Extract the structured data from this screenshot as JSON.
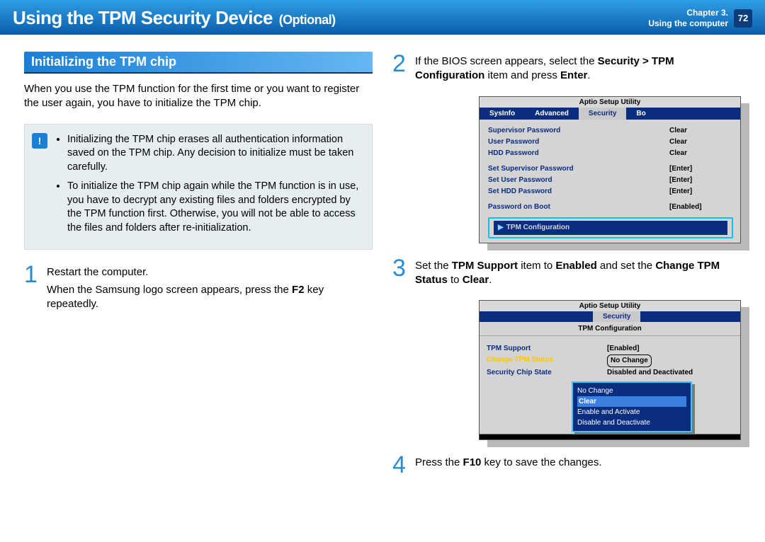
{
  "topbar": {
    "title": "Using the TPM Security Device",
    "subtitle": "(Optional)",
    "chapter_label": "Chapter 3.",
    "chapter_name": "Using the computer",
    "page_number": "72"
  },
  "left": {
    "section_title": "Initializing the TPM chip",
    "intro": "When you use the TPM function for the first time or you want to register the user again, you have to initialize the TPM chip.",
    "note1": "Initializing the TPM chip erases all authentication information saved on the TPM chip. Any decision to initialize must be taken carefully.",
    "note2": "To initialize the TPM chip again while the TPM function is in use, you have to decrypt any existing files and folders encrypted by the TPM function first. Otherwise, you will not be able to access the files and folders after re-initialization.",
    "step1_num": "1",
    "step1_a": "Restart the computer.",
    "step1_b_pre": "When the Samsung logo screen appears, press the ",
    "step1_b_key": "F2",
    "step1_b_post": " key repeatedly."
  },
  "right": {
    "step2_num": "2",
    "step2_pre": "If the BIOS screen appears, select the ",
    "step2_bold1": "Security > TPM Configuration",
    "step2_mid": " item and press ",
    "step2_bold2": "Enter",
    "step2_post": ".",
    "bios1": {
      "title": "Aptio Setup Utility",
      "tabs": [
        "SysInfo",
        "Advanced",
        "Security",
        "Bo"
      ],
      "active_tab_index": 2,
      "rows1": [
        {
          "k": "Supervisor Password",
          "v": "Clear"
        },
        {
          "k": "User Password",
          "v": "Clear"
        },
        {
          "k": "HDD Password",
          "v": "Clear"
        }
      ],
      "rows2": [
        {
          "k": "Set Supervisor Password",
          "v": "[Enter]"
        },
        {
          "k": "Set User Password",
          "v": "[Enter]"
        },
        {
          "k": "Set HDD Password",
          "v": "[Enter]"
        }
      ],
      "rows3": [
        {
          "k": "Password on Boot",
          "v": "[Enabled]"
        }
      ],
      "highlight": "TPM Configuration"
    },
    "step3_num": "3",
    "step3_pre": "Set the ",
    "step3_b1": "TPM Support",
    "step3_mid1": " item to ",
    "step3_b2": "Enabled",
    "step3_mid2": " and set the ",
    "step3_b3": "Change TPM Status",
    "step3_mid3": " to ",
    "step3_b4": "Clear",
    "step3_post": ".",
    "bios2": {
      "title": "Aptio Setup Utility",
      "tab": "Security",
      "subtitle": "TPM Configuration",
      "r1k": "TPM Support",
      "r1v": "[Enabled]",
      "r2k": "Change TPM Status",
      "r2v": "No Change",
      "r3k": "Security Chip State",
      "r3v": "Disabled and Deactivated",
      "options": [
        "No Change",
        "Clear",
        "Enable and Activate",
        "Disable and Deactivate"
      ],
      "selected_index": 1
    },
    "step4_num": "4",
    "step4_pre": "Press the ",
    "step4_b": "F10",
    "step4_post": " key to save the changes."
  }
}
